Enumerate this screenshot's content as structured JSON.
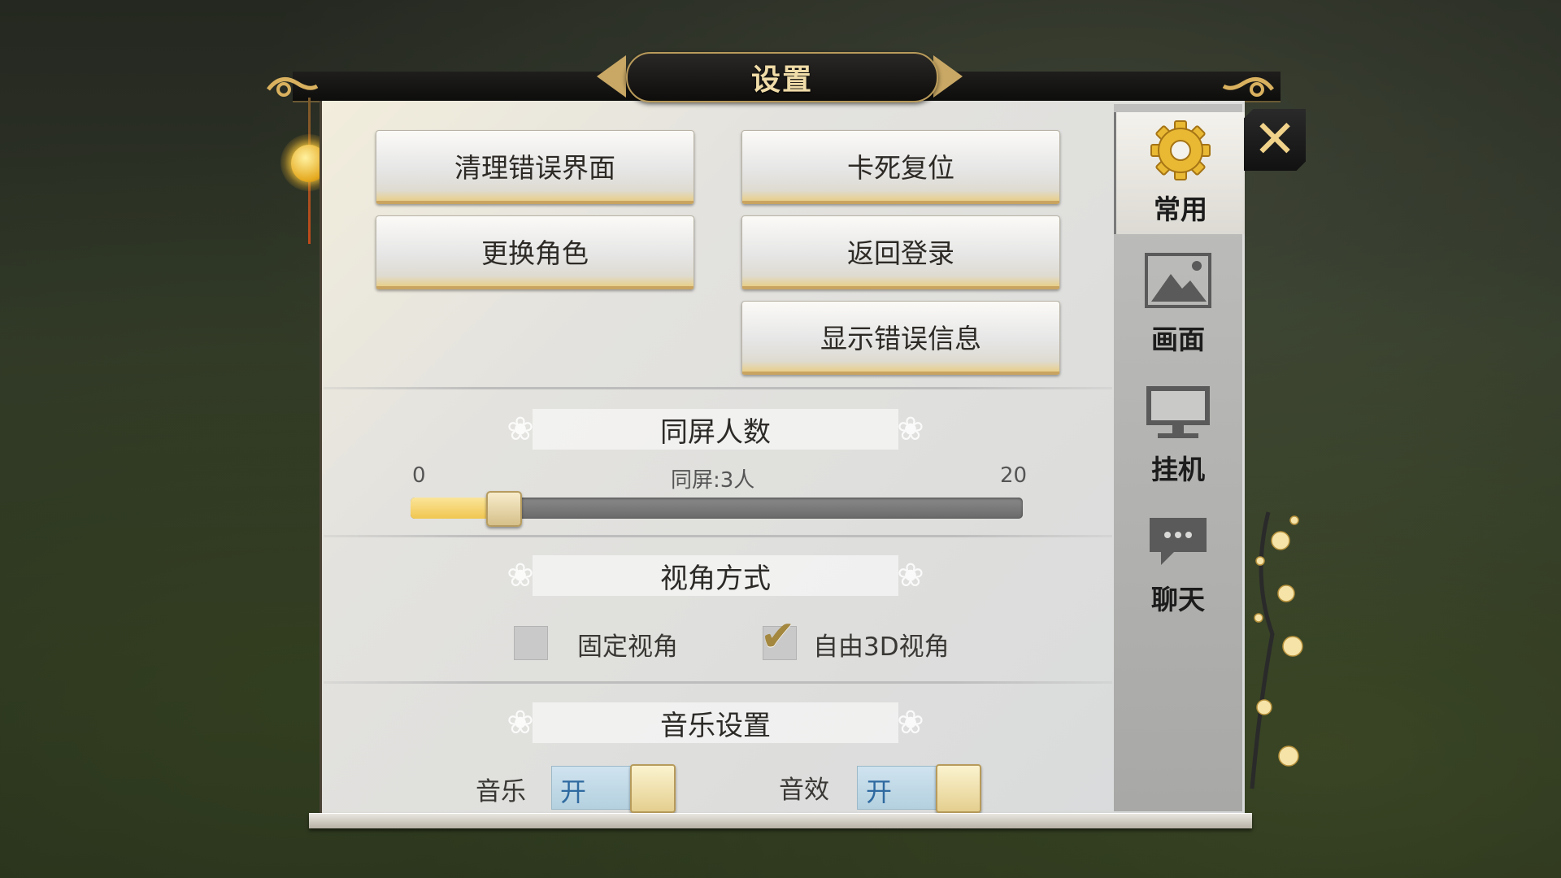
{
  "window": {
    "title": "设置",
    "close_icon": "close-icon"
  },
  "actions": {
    "clear_error_ui": "清理错误界面",
    "stuck_reset": "卡死复位",
    "switch_character": "更换角色",
    "return_login": "返回登录",
    "show_error_info": "显示错误信息"
  },
  "players_on_screen": {
    "header": "同屏人数",
    "min_label": "0",
    "max_label": "20",
    "value_label": "同屏:3人",
    "value_fraction": 0.15
  },
  "camera": {
    "header": "视角方式",
    "fixed_label": "固定视角",
    "fixed_checked": false,
    "free3d_label": "自由3D视角",
    "free3d_checked": true
  },
  "audio": {
    "header": "音乐设置",
    "music_label": "音乐",
    "music_state": "开",
    "sfx_label": "音效",
    "sfx_state": "开"
  },
  "tabs": [
    {
      "label": "常用",
      "icon": "gear-icon",
      "active": true
    },
    {
      "label": "画面",
      "icon": "picture-icon",
      "active": false
    },
    {
      "label": "挂机",
      "icon": "monitor-icon",
      "active": false
    },
    {
      "label": "聊天",
      "icon": "chat-bubble-icon",
      "active": false
    }
  ],
  "colors": {
    "accent_gold": "#c9a460",
    "toggle_blue": "#2f6aa0",
    "slider_fill": "#f0c650"
  }
}
